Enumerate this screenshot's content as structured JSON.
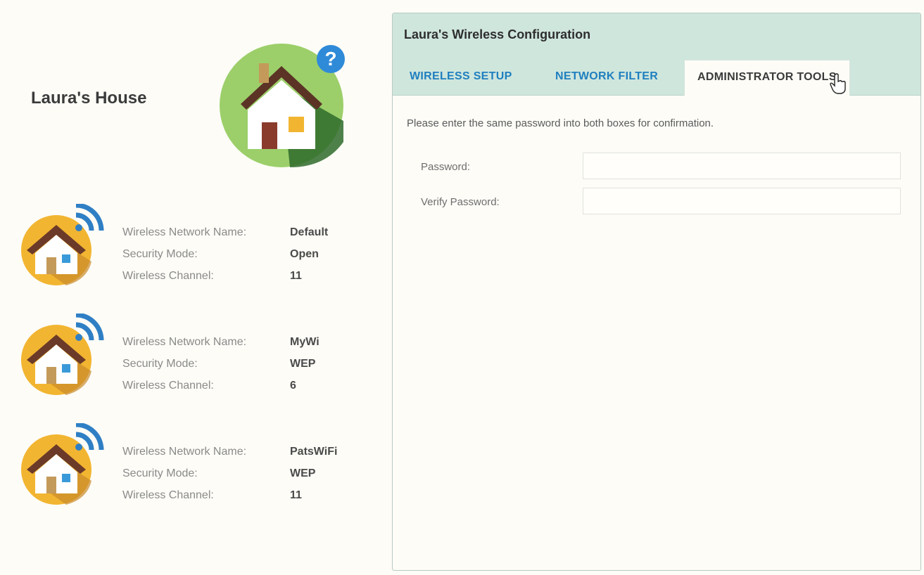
{
  "house": {
    "title": "Laura's House",
    "help_glyph": "?"
  },
  "networks": [
    {
      "name_label": "Wireless Network Name:",
      "name": "Default",
      "security_label": "Security Mode:",
      "security": "Open",
      "channel_label": "Wireless Channel:",
      "channel": "11"
    },
    {
      "name_label": "Wireless Network Name:",
      "name": "MyWi",
      "security_label": "Security Mode:",
      "security": "WEP",
      "channel_label": "Wireless Channel:",
      "channel": "6"
    },
    {
      "name_label": "Wireless Network Name:",
      "name": "PatsWiFi",
      "security_label": "Security Mode:",
      "security": "WEP",
      "channel_label": "Wireless Channel:",
      "channel": "11"
    }
  ],
  "config": {
    "title": "Laura's Wireless Configuration",
    "tabs": [
      {
        "label": "WIRELESS SETUP",
        "active": false
      },
      {
        "label": "NETWORK FILTER",
        "active": false
      },
      {
        "label": "ADMINISTRATOR TOOLS",
        "active": true
      }
    ],
    "instruction": "Please enter the same password into both boxes for confirmation.",
    "password_label": "Password:",
    "password_value": "",
    "verify_label": "Verify Password:",
    "verify_value": ""
  },
  "colors": {
    "header_bg": "#cfe6dd",
    "tab_link": "#1f7fbf",
    "help_icon": "#2f8ad8",
    "house_circle_main": "#9ccf6a",
    "house_circle_network": "#f2b531"
  },
  "icons": {
    "main_house": "house-icon",
    "network_house": "wifi-house-icon",
    "help": "help-icon",
    "cursor": "hand-cursor-icon"
  }
}
